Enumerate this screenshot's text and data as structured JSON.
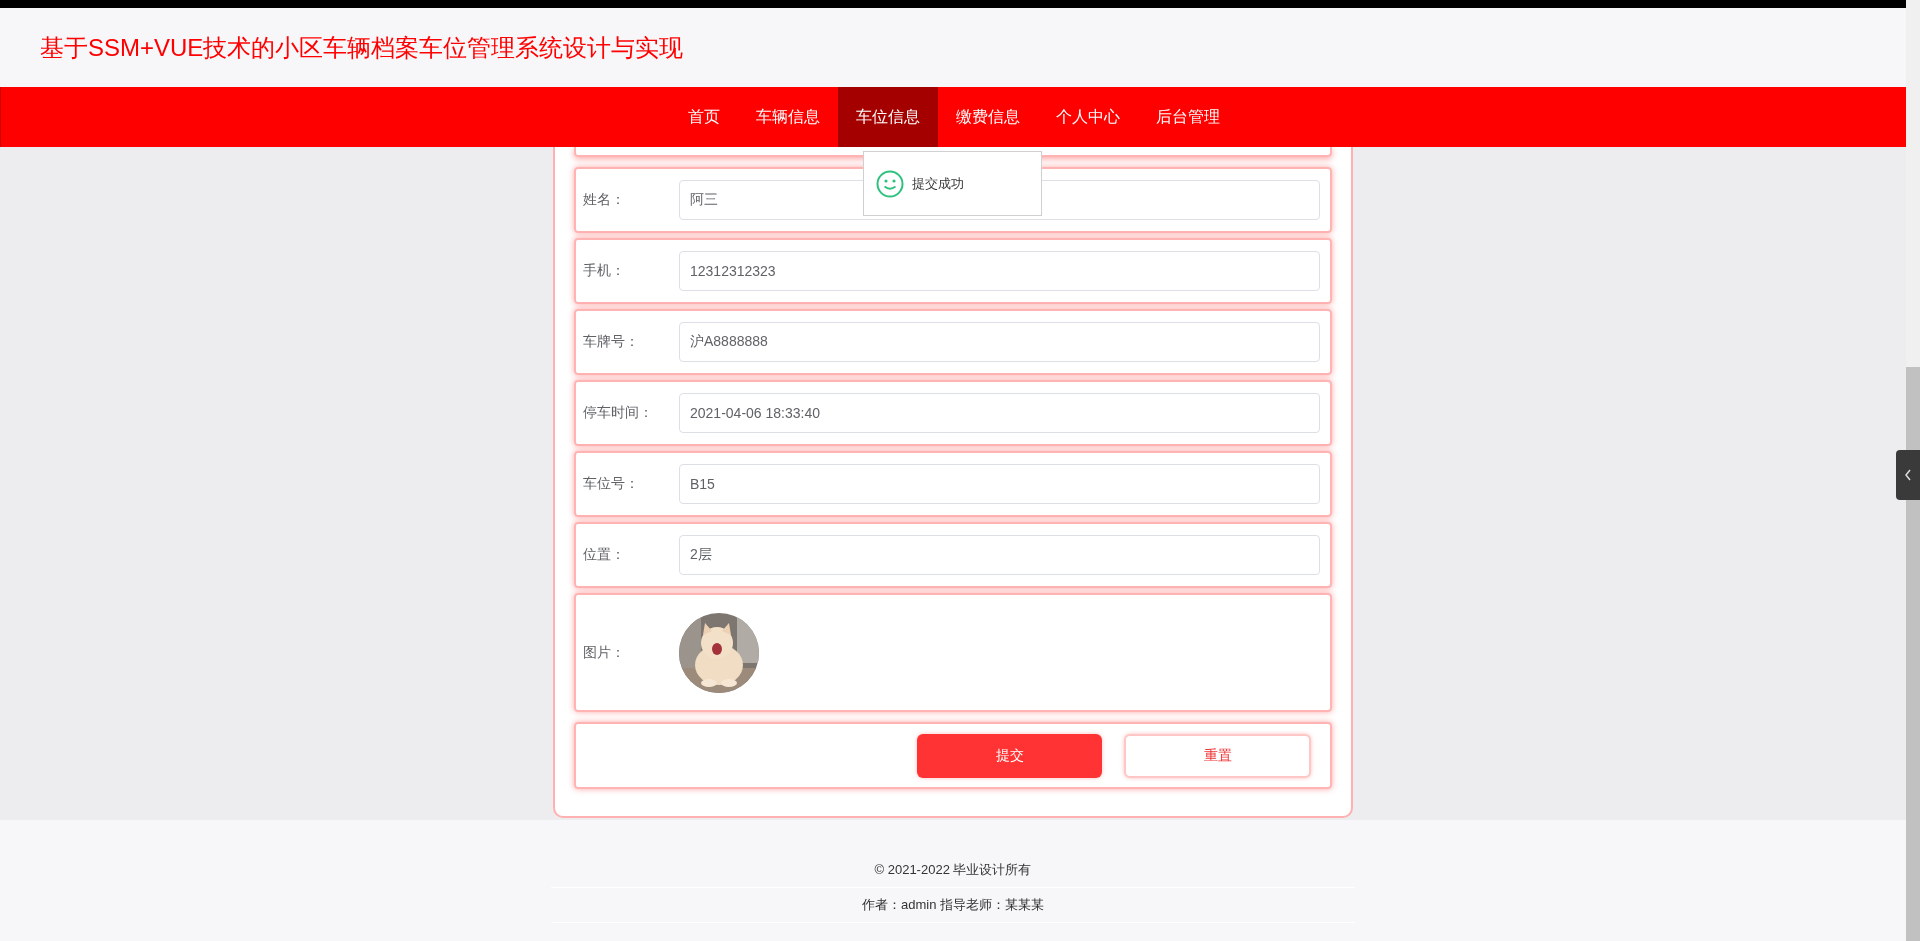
{
  "header": {
    "title": "基于SSM+VUE技术的小区车辆档案车位管理系统设计与实现"
  },
  "nav": [
    {
      "label": "首页",
      "selected": false
    },
    {
      "label": "车辆信息",
      "selected": false
    },
    {
      "label": "车位信息",
      "selected": true
    },
    {
      "label": "缴费信息",
      "selected": false
    },
    {
      "label": "个人中心",
      "selected": false
    },
    {
      "label": "后台管理",
      "selected": false
    }
  ],
  "form": {
    "fields": [
      {
        "kind": "text",
        "label": "姓名：",
        "value": "阿三"
      },
      {
        "kind": "text",
        "label": "手机：",
        "value": "12312312323"
      },
      {
        "kind": "text",
        "label": "车牌号：",
        "value": "沪A8888888"
      },
      {
        "kind": "text",
        "label": "停车时间：",
        "value": "2021-04-06 18:33:40"
      },
      {
        "kind": "text",
        "label": "车位号：",
        "value": "B15"
      },
      {
        "kind": "text",
        "label": "位置：",
        "value": "2层"
      },
      {
        "label": "图片："
      }
    ],
    "buttons": [
      {
        "kind": "primary",
        "label": "提交"
      },
      {
        "kind": "secondary",
        "label": "重置"
      }
    ]
  },
  "toast": {
    "message": "提交成功"
  },
  "footer": {
    "lines": [
      "© 2021-2022 毕业设计所有",
      "作者：admin 指导老师：某某某"
    ]
  }
}
